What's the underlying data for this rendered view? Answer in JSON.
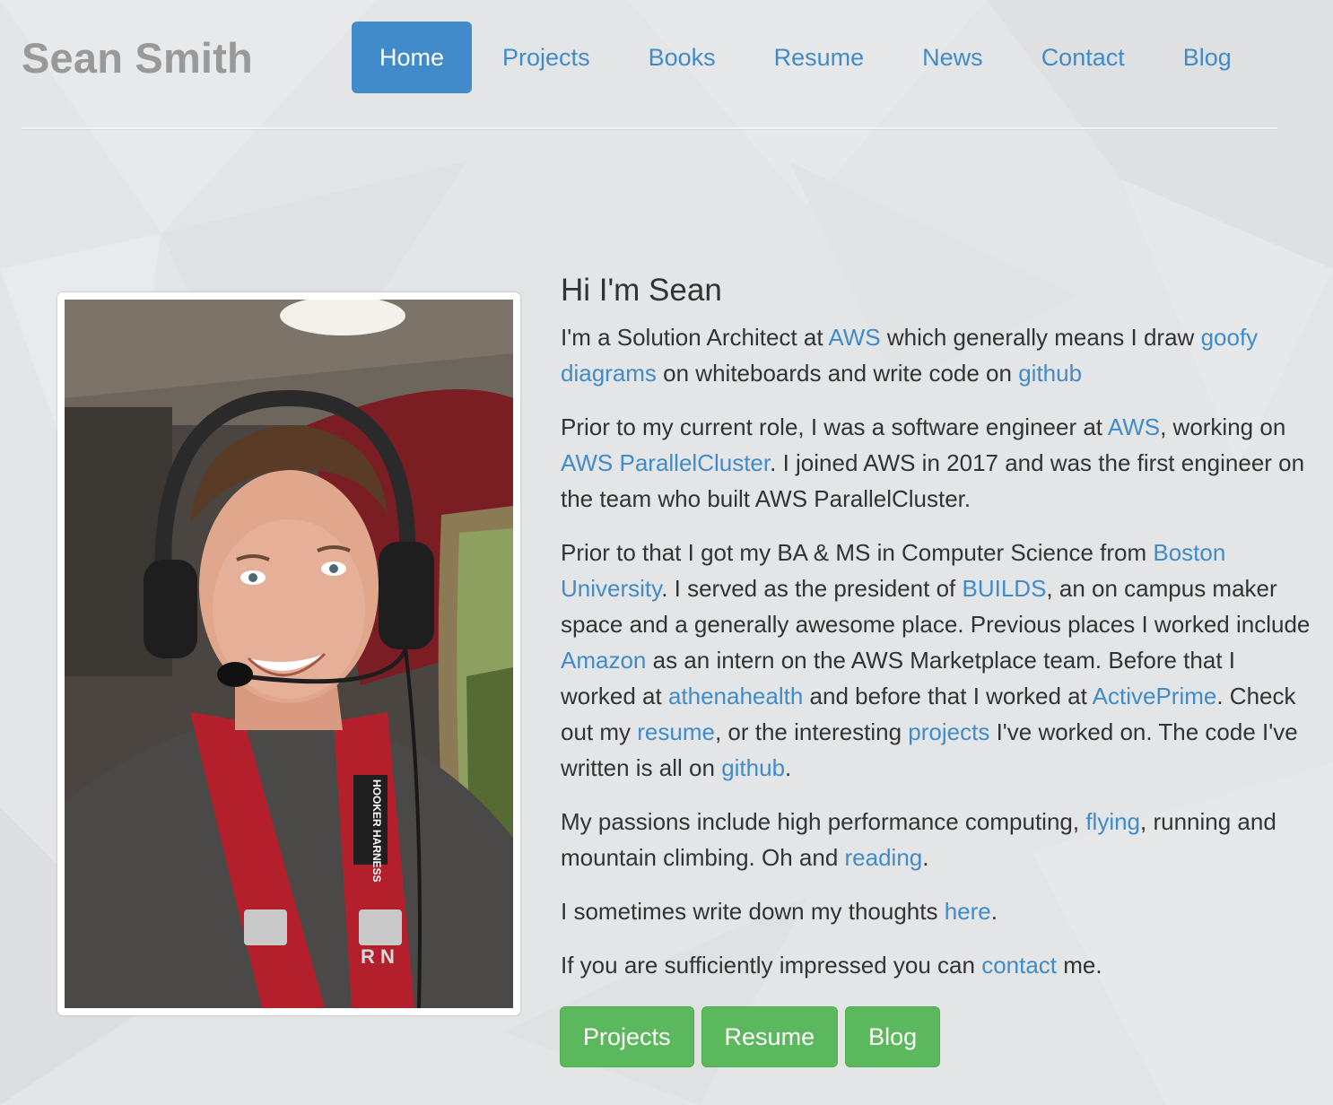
{
  "header": {
    "site_title": "Sean Smith",
    "nav": [
      {
        "label": "Home",
        "active": true
      },
      {
        "label": "Projects",
        "active": false
      },
      {
        "label": "Books",
        "active": false
      },
      {
        "label": "Resume",
        "active": false
      },
      {
        "label": "News",
        "active": false
      },
      {
        "label": "Contact",
        "active": false
      },
      {
        "label": "Blog",
        "active": false
      }
    ]
  },
  "intro": {
    "heading": "Hi I'm Sean",
    "p1": {
      "t1": "I'm a Solution Architect at ",
      "l_aws": "AWS",
      "t2": " which generally means I draw ",
      "l_diagrams": "goofy diagrams",
      "t3": " on whiteboards and write code on ",
      "l_github": "github"
    },
    "p2": {
      "t1": "Prior to my current role, I was a software engineer at ",
      "l_aws": "AWS",
      "t2": ", working on ",
      "l_parallelcluster": "AWS ParallelCluster",
      "t3": ". I joined AWS in 2017 and was the first engineer on the team who built AWS ParallelCluster."
    },
    "p3": {
      "t1": "Prior to that I got my BA & MS in Computer Science from ",
      "l_bu": "Boston University",
      "t2": ". I served as the president of ",
      "l_builds": "BUILDS",
      "t3": ", an on campus maker space and a generally awesome place. Previous places I worked include ",
      "l_amazon": "Amazon",
      "t4": " as an intern on the AWS Marketplace team. Before that I worked at ",
      "l_athena": "athenahealth",
      "t5": " and before that I worked at ",
      "l_activeprime": "ActivePrime",
      "t6": ". Check out my ",
      "l_resume": "resume",
      "t7": ", or the interesting ",
      "l_projects": "projects",
      "t8": " I've worked on. The code I've written is all on ",
      "l_github": "github",
      "t9": "."
    },
    "p4": {
      "t1": "My passions include high performance computing, ",
      "l_flying": "flying",
      "t2": ", running and mountain climbing. Oh and ",
      "l_reading": "reading",
      "t3": "."
    },
    "p5": {
      "t1": "I sometimes write down my thoughts ",
      "l_here": "here",
      "t2": "."
    },
    "p6": {
      "t1": "If you are sufficiently impressed you can ",
      "l_contact": "contact",
      "t2": " me."
    }
  },
  "buttons": {
    "projects": "Projects",
    "resume": "Resume",
    "blog": "Blog"
  },
  "photo": {
    "harness_text": "HOOKER HARNESS",
    "shirt_text": "R  N"
  },
  "colors": {
    "link": "#428bca",
    "nav_active_bg": "#428bca",
    "button_green": "#5cb85c",
    "title_gray": "#999999",
    "background": "#e3e5e6"
  }
}
